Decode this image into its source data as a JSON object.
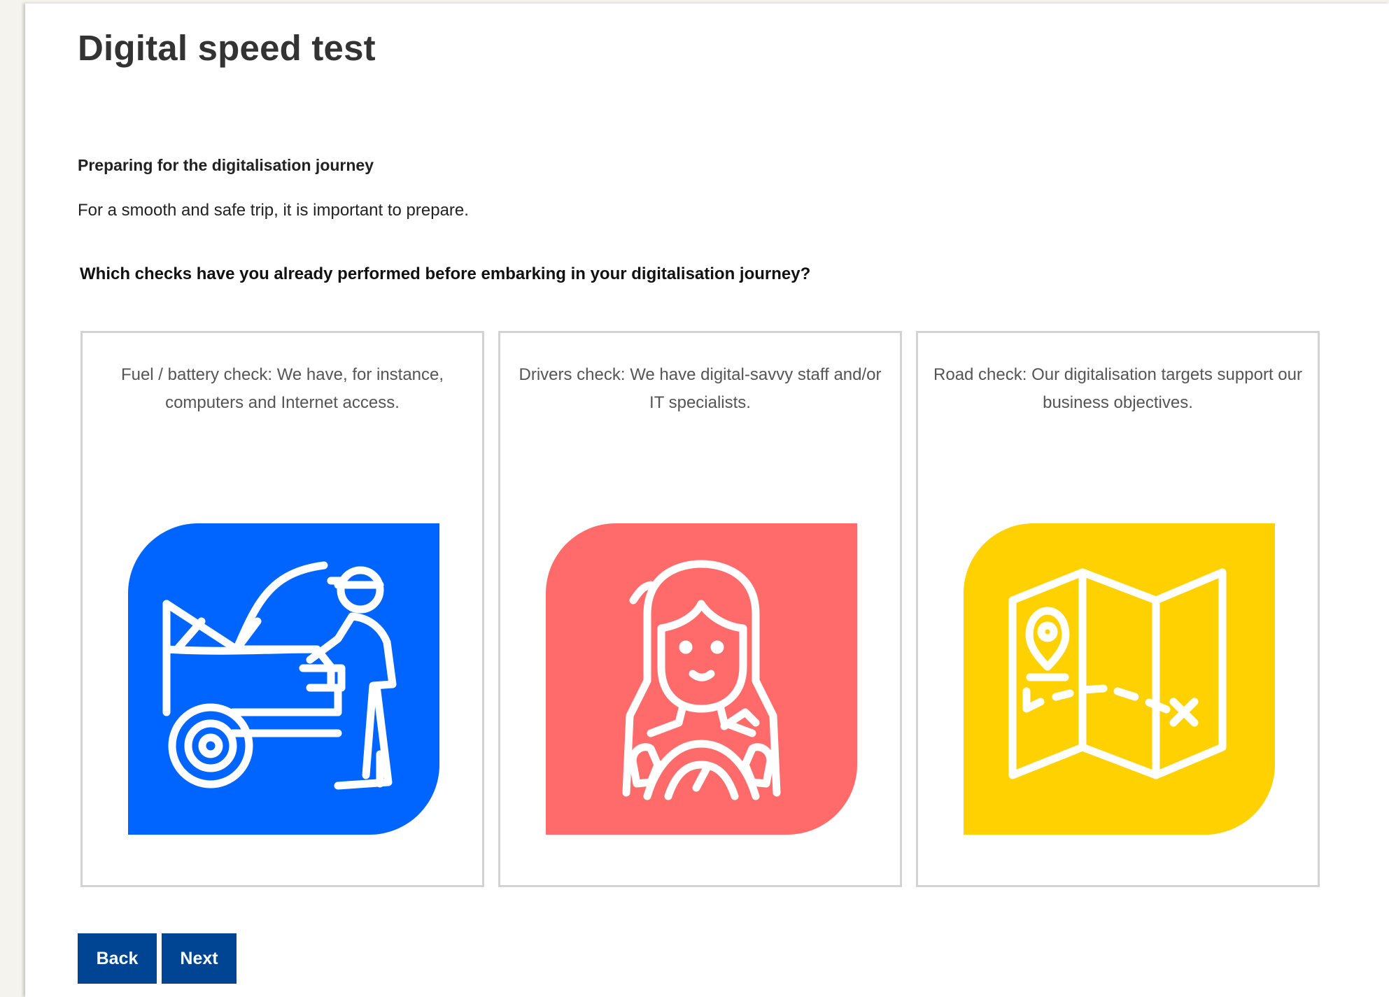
{
  "page": {
    "title": "Digital speed test",
    "subtitle": "Preparing for the digitalisation journey",
    "intro": "For a smooth and safe trip, it is important to prepare.",
    "question": "Which checks have you already performed before embarking in your digitalisation journey?"
  },
  "options": [
    {
      "text": "Fuel / battery check: We have, for instance, computers and Internet access.",
      "icon": "car-mechanic-icon",
      "color": "#0065ff"
    },
    {
      "text": "Drivers check: We have digital-savvy staff and/or IT specialists.",
      "icon": "driver-icon",
      "color": "#ff6b6b"
    },
    {
      "text": "Road check: Our digitalisation targets support our business objectives.",
      "icon": "map-route-icon",
      "color": "#ffd100"
    }
  ],
  "buttons": {
    "back": "Back",
    "next": "Next"
  },
  "colors": {
    "primary_button": "#004494",
    "background": "#f5f3ee"
  }
}
